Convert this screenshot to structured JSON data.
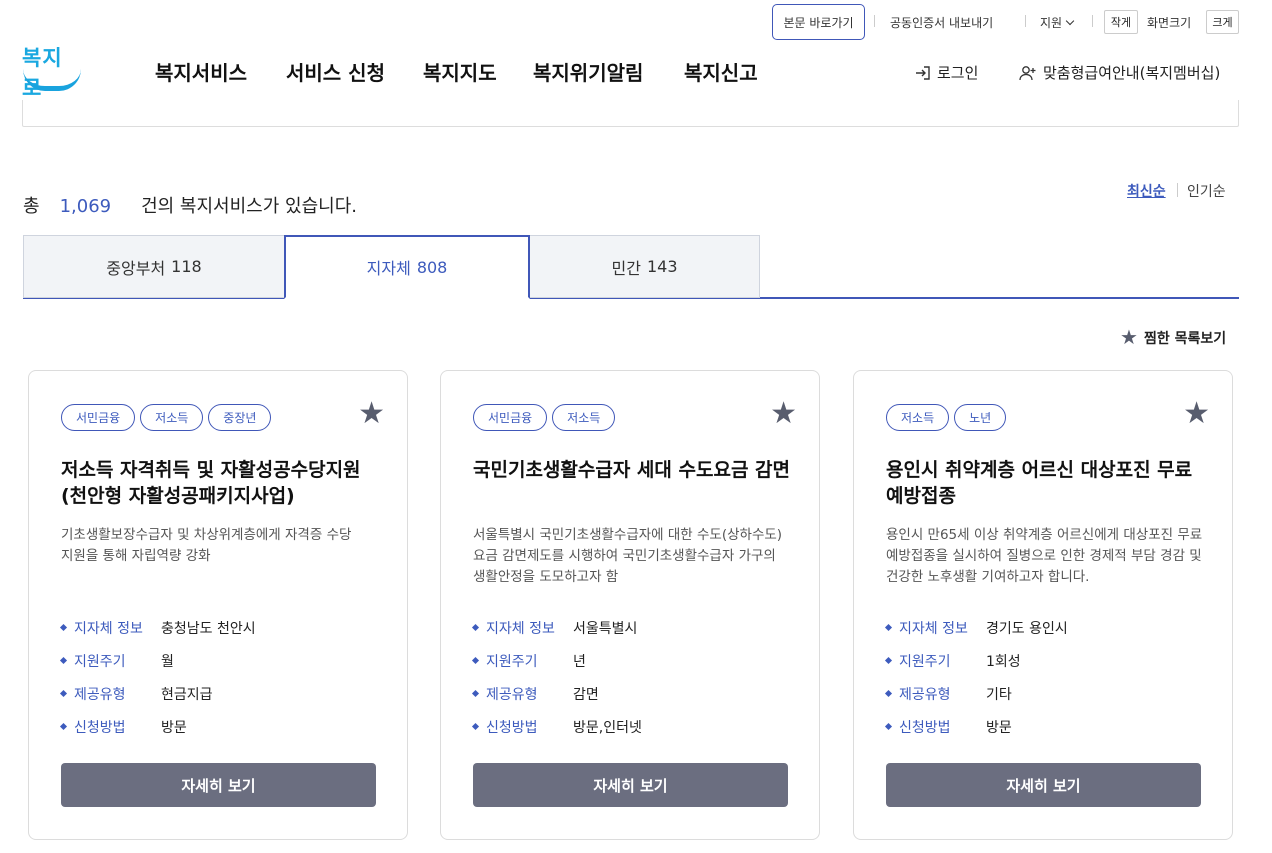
{
  "header": {
    "skip_link": "본문 바로가기",
    "cert_export": "공동인증서 내보내기",
    "language": "지원",
    "size_small": "작게",
    "size_label": "화면크기",
    "size_large": "크게",
    "logo_text": "복지로",
    "nav": [
      "복지서비스",
      "서비스 신청",
      "복지지도",
      "복지위기알림",
      "복지신고"
    ],
    "login": "로그인",
    "member": "맞춤형급여안내(복지멤버십)"
  },
  "summary": {
    "prefix": "총",
    "count": "1,069",
    "suffix": "건의 복지서비스가 있습니다.",
    "sort_latest": "최신순",
    "sort_popular": "인기순"
  },
  "tabs": [
    {
      "label": "중앙부처",
      "count": "118",
      "active": false
    },
    {
      "label": "지자체",
      "count": "808",
      "active": true
    },
    {
      "label": "민간",
      "count": "143",
      "active": false
    }
  ],
  "favorites_link": "찜한 목록보기",
  "info_labels": {
    "region": "지자체 정보",
    "cycle": "지원주기",
    "type": "제공유형",
    "method": "신청방법"
  },
  "cards": [
    {
      "tags": [
        "서민금융",
        "저소득",
        "중장년"
      ],
      "title": "저소득 자격취득 및 자활성공수당지원(천안형 자활성공패키지사업)",
      "desc": "기초생활보장수급자 및 차상위계층에게 자격증 수당 지원을 통해 자립역량 강화",
      "region": "충청남도 천안시",
      "cycle": "월",
      "type": "현금지급",
      "method": "방문",
      "button": "자세히 보기"
    },
    {
      "tags": [
        "서민금융",
        "저소득"
      ],
      "title": "국민기초생활수급자 세대 수도요금 감면",
      "desc": "서울특별시 국민기초생활수급자에 대한 수도(상하수도)요금 감면제도를 시행하여 국민기초생활수급자 가구의 생활안정을 도모하고자 함",
      "region": "서울특별시",
      "cycle": "년",
      "type": "감면",
      "method": "방문,인터넷",
      "button": "자세히 보기"
    },
    {
      "tags": [
        "저소득",
        "노년"
      ],
      "title": "용인시 취약계층 어르신 대상포진 무료 예방접종",
      "desc": "용인시 만65세 이상 취약계층 어르신에게 대상포진 무료 예방접종을 실시하여 질병으로 인한 경제적 부담 경감 및 건강한 노후생활 기여하고자 합니다.",
      "region": "경기도 용인시",
      "cycle": "1회성",
      "type": "기타",
      "method": "방문",
      "button": "자세히 보기"
    }
  ]
}
